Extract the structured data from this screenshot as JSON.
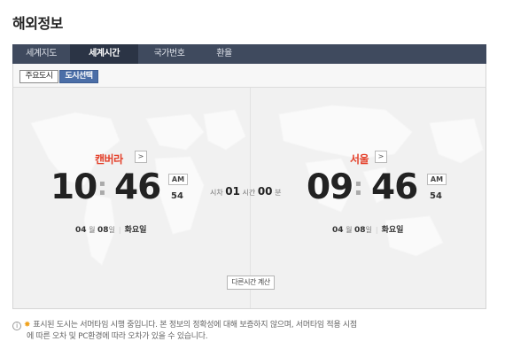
{
  "page": {
    "title": "해외정보"
  },
  "tabs": [
    {
      "label": "세계지도",
      "active": false
    },
    {
      "label": "세계시간",
      "active": true
    },
    {
      "label": "국가번호",
      "active": false
    },
    {
      "label": "환율",
      "active": false
    }
  ],
  "subtabs": [
    {
      "label": "주요도시",
      "active": false
    },
    {
      "label": "도시선택",
      "active": true
    }
  ],
  "left_clock": {
    "city": "캔버라",
    "arrow": ">",
    "hour": "10",
    "minute": "46",
    "ampm": "AM",
    "seconds": "54",
    "month": "04",
    "month_unit": "월",
    "day": "08",
    "day_unit": "일",
    "weekday": "화요일"
  },
  "right_clock": {
    "city": "서울",
    "arrow": ">",
    "hour": "09",
    "minute": "46",
    "ampm": "AM",
    "seconds": "54",
    "month": "04",
    "month_unit": "월",
    "day": "08",
    "day_unit": "일",
    "weekday": "화요일"
  },
  "time_diff": {
    "prefix": "시차",
    "hours": "01",
    "hours_unit": "시간",
    "minutes": "00",
    "minutes_unit": "분"
  },
  "calc_button": "다른시간 계산",
  "notice": {
    "line1": "표시된 도시는 서머타임 시행 중입니다. 본 정보의 정확성에 대해 보증하지 않으며, 서머타임 적용 시점",
    "line2": "에 따른 오차 및 PC환경에 따라 오차가 있을 수 있습니다."
  },
  "colors": {
    "tab_bg": "#3f4a5e",
    "tab_active_bg": "#2b3445",
    "city_red": "#e4402a",
    "selected_subtab": "#4b6ea7",
    "star": "#f0a21d"
  }
}
